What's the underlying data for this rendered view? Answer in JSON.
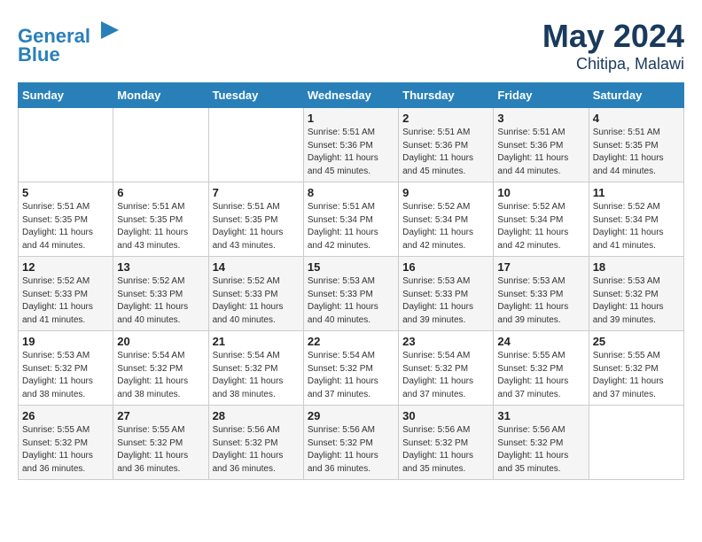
{
  "header": {
    "logo_line1": "General",
    "logo_line2": "Blue",
    "month_year": "May 2024",
    "location": "Chitipa, Malawi"
  },
  "weekdays": [
    "Sunday",
    "Monday",
    "Tuesday",
    "Wednesday",
    "Thursday",
    "Friday",
    "Saturday"
  ],
  "weeks": [
    [
      {
        "day": "",
        "content": ""
      },
      {
        "day": "",
        "content": ""
      },
      {
        "day": "",
        "content": ""
      },
      {
        "day": "1",
        "content": "Sunrise: 5:51 AM\nSunset: 5:36 PM\nDaylight: 11 hours\nand 45 minutes."
      },
      {
        "day": "2",
        "content": "Sunrise: 5:51 AM\nSunset: 5:36 PM\nDaylight: 11 hours\nand 45 minutes."
      },
      {
        "day": "3",
        "content": "Sunrise: 5:51 AM\nSunset: 5:36 PM\nDaylight: 11 hours\nand 44 minutes."
      },
      {
        "day": "4",
        "content": "Sunrise: 5:51 AM\nSunset: 5:35 PM\nDaylight: 11 hours\nand 44 minutes."
      }
    ],
    [
      {
        "day": "5",
        "content": "Sunrise: 5:51 AM\nSunset: 5:35 PM\nDaylight: 11 hours\nand 44 minutes."
      },
      {
        "day": "6",
        "content": "Sunrise: 5:51 AM\nSunset: 5:35 PM\nDaylight: 11 hours\nand 43 minutes."
      },
      {
        "day": "7",
        "content": "Sunrise: 5:51 AM\nSunset: 5:35 PM\nDaylight: 11 hours\nand 43 minutes."
      },
      {
        "day": "8",
        "content": "Sunrise: 5:51 AM\nSunset: 5:34 PM\nDaylight: 11 hours\nand 42 minutes."
      },
      {
        "day": "9",
        "content": "Sunrise: 5:52 AM\nSunset: 5:34 PM\nDaylight: 11 hours\nand 42 minutes."
      },
      {
        "day": "10",
        "content": "Sunrise: 5:52 AM\nSunset: 5:34 PM\nDaylight: 11 hours\nand 42 minutes."
      },
      {
        "day": "11",
        "content": "Sunrise: 5:52 AM\nSunset: 5:34 PM\nDaylight: 11 hours\nand 41 minutes."
      }
    ],
    [
      {
        "day": "12",
        "content": "Sunrise: 5:52 AM\nSunset: 5:33 PM\nDaylight: 11 hours\nand 41 minutes."
      },
      {
        "day": "13",
        "content": "Sunrise: 5:52 AM\nSunset: 5:33 PM\nDaylight: 11 hours\nand 40 minutes."
      },
      {
        "day": "14",
        "content": "Sunrise: 5:52 AM\nSunset: 5:33 PM\nDaylight: 11 hours\nand 40 minutes."
      },
      {
        "day": "15",
        "content": "Sunrise: 5:53 AM\nSunset: 5:33 PM\nDaylight: 11 hours\nand 40 minutes."
      },
      {
        "day": "16",
        "content": "Sunrise: 5:53 AM\nSunset: 5:33 PM\nDaylight: 11 hours\nand 39 minutes."
      },
      {
        "day": "17",
        "content": "Sunrise: 5:53 AM\nSunset: 5:33 PM\nDaylight: 11 hours\nand 39 minutes."
      },
      {
        "day": "18",
        "content": "Sunrise: 5:53 AM\nSunset: 5:32 PM\nDaylight: 11 hours\nand 39 minutes."
      }
    ],
    [
      {
        "day": "19",
        "content": "Sunrise: 5:53 AM\nSunset: 5:32 PM\nDaylight: 11 hours\nand 38 minutes."
      },
      {
        "day": "20",
        "content": "Sunrise: 5:54 AM\nSunset: 5:32 PM\nDaylight: 11 hours\nand 38 minutes."
      },
      {
        "day": "21",
        "content": "Sunrise: 5:54 AM\nSunset: 5:32 PM\nDaylight: 11 hours\nand 38 minutes."
      },
      {
        "day": "22",
        "content": "Sunrise: 5:54 AM\nSunset: 5:32 PM\nDaylight: 11 hours\nand 37 minutes."
      },
      {
        "day": "23",
        "content": "Sunrise: 5:54 AM\nSunset: 5:32 PM\nDaylight: 11 hours\nand 37 minutes."
      },
      {
        "day": "24",
        "content": "Sunrise: 5:55 AM\nSunset: 5:32 PM\nDaylight: 11 hours\nand 37 minutes."
      },
      {
        "day": "25",
        "content": "Sunrise: 5:55 AM\nSunset: 5:32 PM\nDaylight: 11 hours\nand 37 minutes."
      }
    ],
    [
      {
        "day": "26",
        "content": "Sunrise: 5:55 AM\nSunset: 5:32 PM\nDaylight: 11 hours\nand 36 minutes."
      },
      {
        "day": "27",
        "content": "Sunrise: 5:55 AM\nSunset: 5:32 PM\nDaylight: 11 hours\nand 36 minutes."
      },
      {
        "day": "28",
        "content": "Sunrise: 5:56 AM\nSunset: 5:32 PM\nDaylight: 11 hours\nand 36 minutes."
      },
      {
        "day": "29",
        "content": "Sunrise: 5:56 AM\nSunset: 5:32 PM\nDaylight: 11 hours\nand 36 minutes."
      },
      {
        "day": "30",
        "content": "Sunrise: 5:56 AM\nSunset: 5:32 PM\nDaylight: 11 hours\nand 35 minutes."
      },
      {
        "day": "31",
        "content": "Sunrise: 5:56 AM\nSunset: 5:32 PM\nDaylight: 11 hours\nand 35 minutes."
      },
      {
        "day": "",
        "content": ""
      }
    ]
  ]
}
